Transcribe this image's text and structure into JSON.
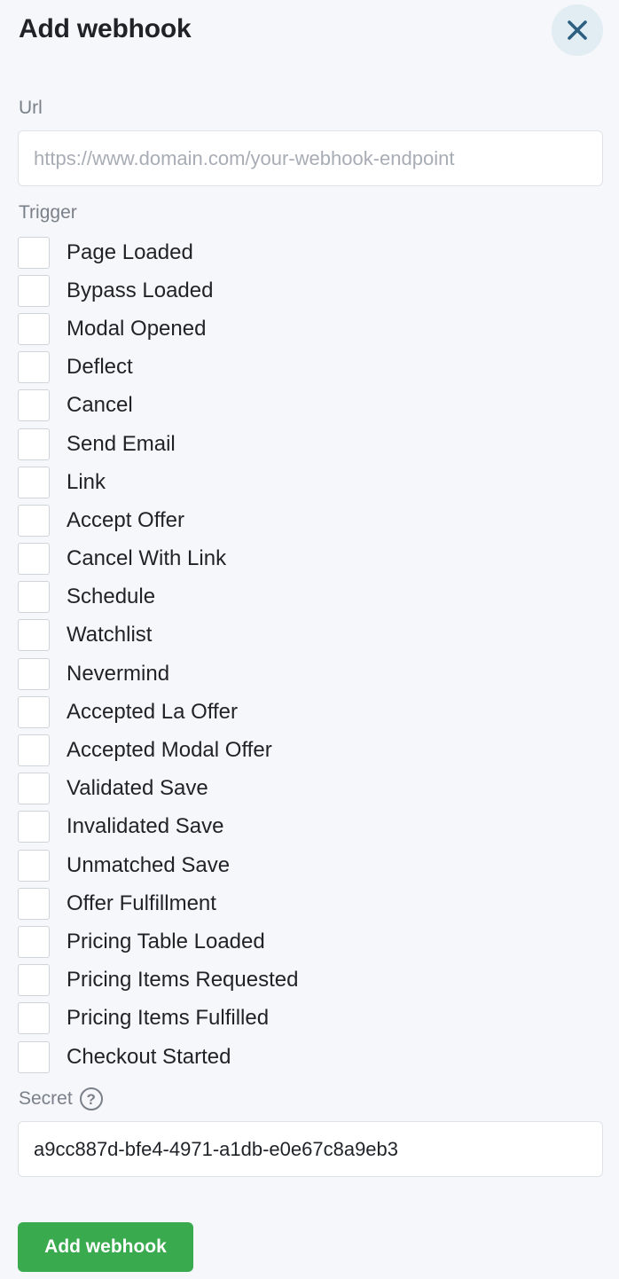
{
  "header": {
    "title": "Add webhook",
    "close_icon": "close-icon"
  },
  "url_field": {
    "label": "Url",
    "value": "",
    "placeholder": "https://www.domain.com/your-webhook-endpoint"
  },
  "trigger": {
    "label": "Trigger",
    "items": [
      {
        "label": "Page Loaded",
        "checked": false
      },
      {
        "label": "Bypass Loaded",
        "checked": false
      },
      {
        "label": "Modal Opened",
        "checked": false
      },
      {
        "label": "Deflect",
        "checked": false
      },
      {
        "label": "Cancel",
        "checked": false
      },
      {
        "label": "Send Email",
        "checked": false
      },
      {
        "label": "Link",
        "checked": false
      },
      {
        "label": "Accept Offer",
        "checked": false
      },
      {
        "label": "Cancel With Link",
        "checked": false
      },
      {
        "label": "Schedule",
        "checked": false
      },
      {
        "label": "Watchlist",
        "checked": false
      },
      {
        "label": "Nevermind",
        "checked": false
      },
      {
        "label": "Accepted La Offer",
        "checked": false
      },
      {
        "label": "Accepted Modal Offer",
        "checked": false
      },
      {
        "label": "Validated Save",
        "checked": false
      },
      {
        "label": "Invalidated Save",
        "checked": false
      },
      {
        "label": "Unmatched Save",
        "checked": false
      },
      {
        "label": "Offer Fulfillment",
        "checked": false
      },
      {
        "label": "Pricing Table Loaded",
        "checked": false
      },
      {
        "label": "Pricing Items Requested",
        "checked": false
      },
      {
        "label": "Pricing Items Fulfilled",
        "checked": false
      },
      {
        "label": "Checkout Started",
        "checked": false
      }
    ]
  },
  "secret_field": {
    "label": "Secret",
    "help_icon": "help-icon",
    "help_glyph": "?",
    "value": "a9cc887d-bfe4-4971-a1db-e0e67c8a9eb3"
  },
  "submit": {
    "label": "Add webhook"
  },
  "colors": {
    "background": "#f5f7fa",
    "close_button_bg": "#e2ecf3",
    "close_icon": "#2d5f80",
    "submit_bg": "#3aaa4f"
  }
}
